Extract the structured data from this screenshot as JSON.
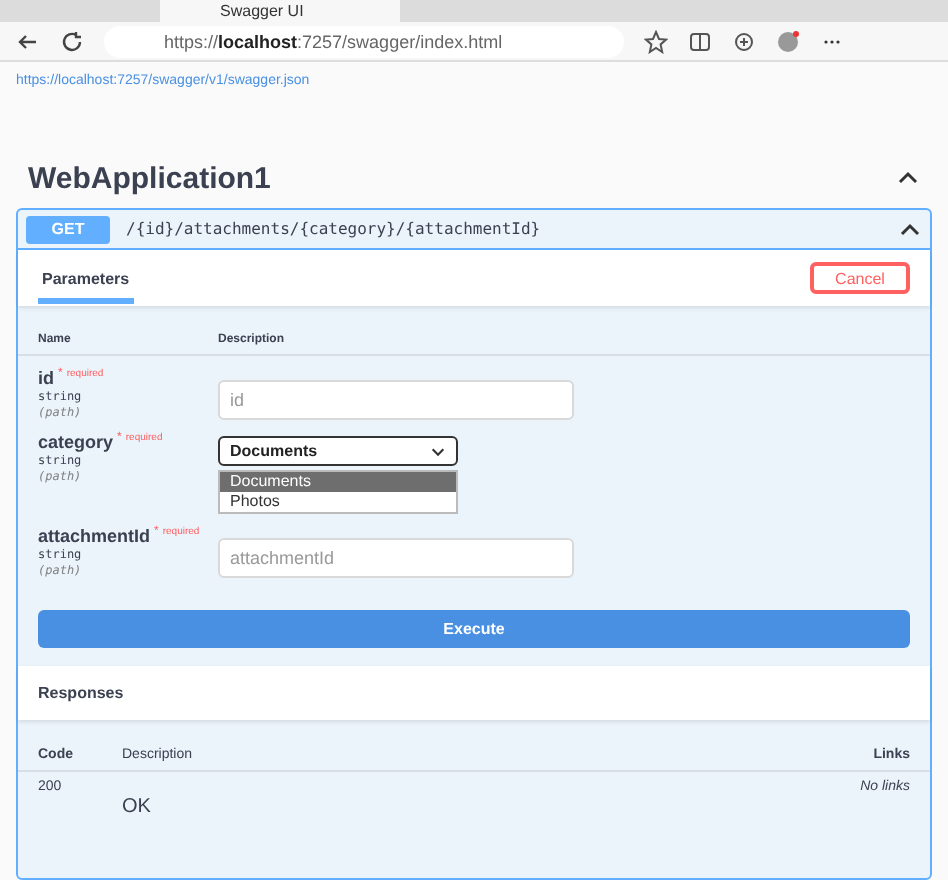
{
  "browser": {
    "tab_title": "Swagger UI",
    "url_prefix": "https://",
    "url_host": "localhost",
    "url_rest": ":7257/swagger/index.html"
  },
  "spec_link": "https://localhost:7257/swagger/v1/swagger.json",
  "section": {
    "title": "WebApplication1",
    "expanded": true
  },
  "operation": {
    "method": "GET",
    "path": "/{id}/attachments/{category}/{attachmentId}",
    "expanded": true,
    "tab": {
      "label": "Parameters",
      "selected": true
    },
    "cancel": "Cancel",
    "columns": [
      "Name",
      "Description"
    ],
    "parameters": [
      {
        "name": "id",
        "required_mark": "*",
        "required": "required",
        "type": "string",
        "location": "(path)",
        "kind": "input",
        "placeholder": "id"
      },
      {
        "name": "category",
        "required_mark": "*",
        "required": "required",
        "type": "string",
        "location": "(path)",
        "kind": "select",
        "value": "Documents",
        "options": [
          {
            "label": "Documents",
            "selected": true
          },
          {
            "label": "Photos",
            "selected": false
          }
        ]
      },
      {
        "name": "attachmentId",
        "required_mark": "*",
        "required": "required",
        "type": "string",
        "location": "(path)",
        "kind": "input",
        "placeholder": "attachmentId"
      }
    ],
    "execute": "Execute",
    "responses_title": "Responses",
    "response_columns": [
      "Code",
      "Description",
      "Links"
    ],
    "responses": [
      {
        "code": "200",
        "description": "OK",
        "links": "No links"
      }
    ]
  }
}
